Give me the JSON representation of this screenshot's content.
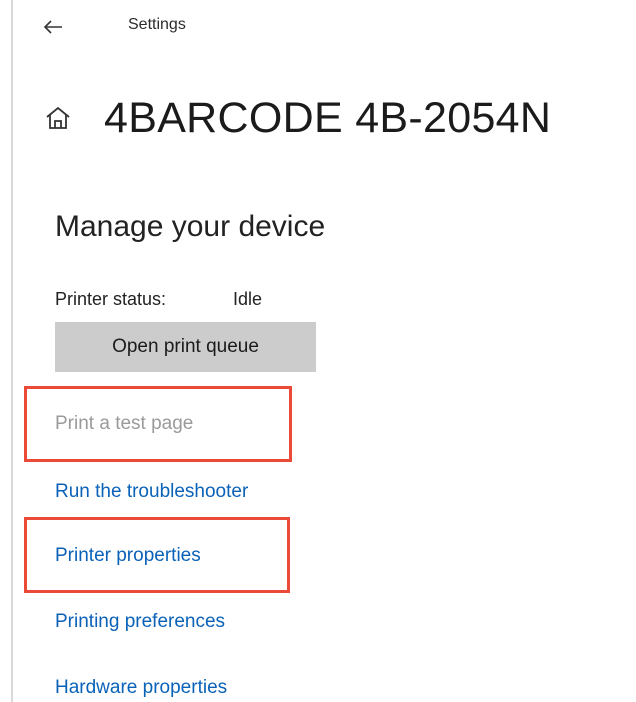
{
  "header": {
    "app_title": "Settings"
  },
  "page": {
    "title": "4BARCODE 4B-2054N"
  },
  "manage": {
    "section_title": "Manage your device",
    "status_label": "Printer status:",
    "status_value": "Idle",
    "open_queue_label": "Open print queue"
  },
  "links": {
    "print_test_page": "Print a test page",
    "run_troubleshooter": "Run the troubleshooter",
    "printer_properties": "Printer properties",
    "printing_preferences": "Printing preferences",
    "hardware_properties": "Hardware properties"
  },
  "colors": {
    "link": "#0a62b8",
    "disabled_link": "#9a9a9a",
    "button_bg": "#cccccc",
    "highlight_border": "#ea4a36"
  },
  "icons": {
    "back": "arrow-left-icon",
    "home": "home-icon"
  }
}
